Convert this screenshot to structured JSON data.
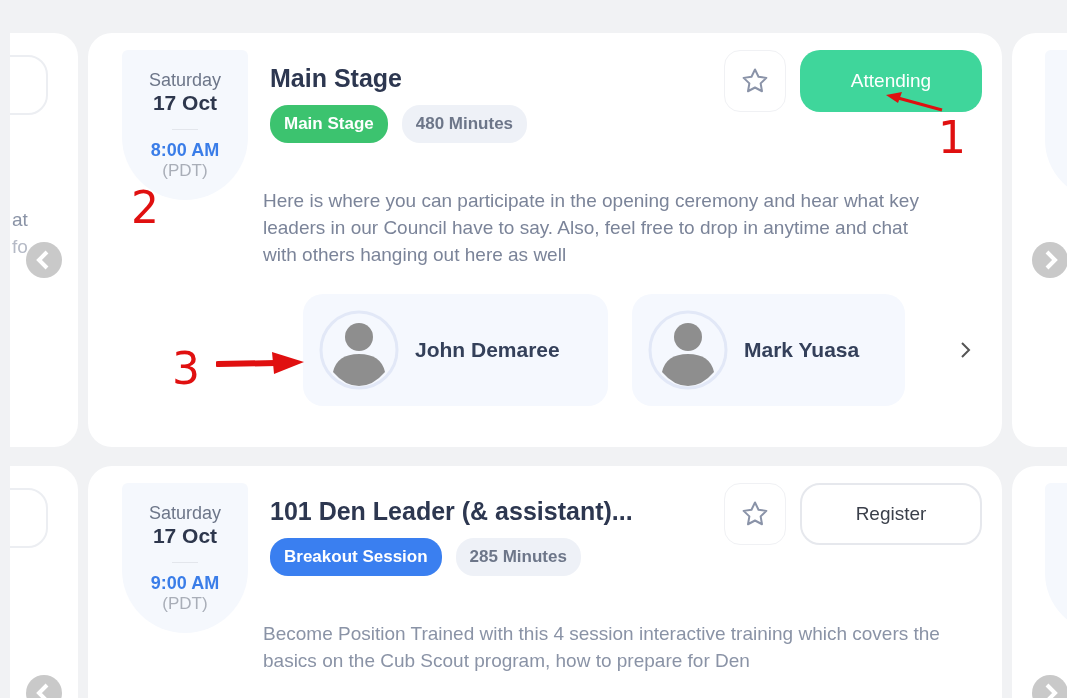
{
  "left_peek": [
    "at",
    "fo"
  ],
  "sessions": [
    {
      "day": "Saturday",
      "date": "17 Oct",
      "time": "8:00 AM",
      "zone": "(PDT)",
      "title": "Main Stage",
      "tag": {
        "label": "Main Stage",
        "color": "#3cc36f"
      },
      "duration": "480 Minutes",
      "favorite": false,
      "action": {
        "label": "Attending",
        "kind": "attending"
      },
      "description": "Here is where you can participate in the opening ceremony and hear what key leaders in our Council have to say. Also, feel free to drop in anytime and chat with others hanging out here as well",
      "speakers": [
        {
          "name": "John Demaree"
        },
        {
          "name": "Mark Yuasa"
        }
      ]
    },
    {
      "day": "Saturday",
      "date": "17 Oct",
      "time": "9:00 AM",
      "zone": "(PDT)",
      "title": "101 Den Leader (& assistant)...",
      "tag": {
        "label": "Breakout Session",
        "color": "#3a7ff0"
      },
      "duration": "285 Minutes",
      "favorite": false,
      "action": {
        "label": "Register",
        "kind": "register"
      },
      "description": "Become Position Trained with this 4 session interactive training which covers the basics on the Cub Scout program, how to prepare for Den"
    }
  ],
  "annotations": [
    {
      "label": "1"
    },
    {
      "label": "2"
    },
    {
      "label": "3"
    }
  ]
}
